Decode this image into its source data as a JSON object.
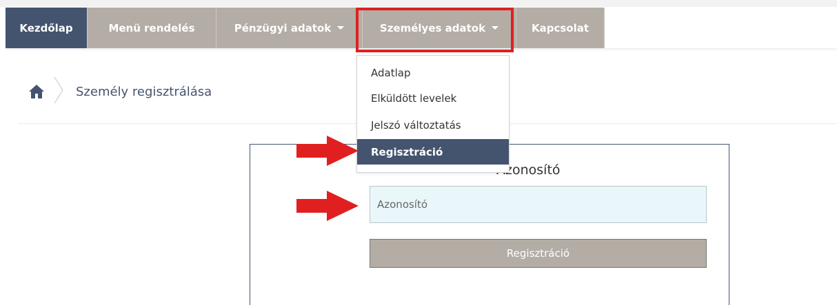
{
  "nav": {
    "items": [
      {
        "label": "Kezdőlap"
      },
      {
        "label": "Menü rendelés"
      },
      {
        "label": "Pénzügyi adatok"
      },
      {
        "label": "Személyes adatok"
      },
      {
        "label": "Kapcsolat"
      }
    ]
  },
  "dropdown": {
    "items": [
      {
        "label": "Adatlap"
      },
      {
        "label": "Elküldött levelek"
      },
      {
        "label": "Jelszó változtatás"
      },
      {
        "label": "Regisztráció",
        "active": true
      }
    ]
  },
  "breadcrumb": {
    "icon": "home-icon",
    "current": "Személy regisztrálása"
  },
  "form": {
    "title": "Azonosító",
    "input": {
      "placeholder": "Azonosító",
      "value": ""
    },
    "submit_label": "Regisztráció"
  },
  "colors": {
    "primary": "#44546f",
    "nav_inactive": "#b3ada5",
    "annotation_red": "#e02020",
    "input_bg": "#e9f7fb"
  }
}
